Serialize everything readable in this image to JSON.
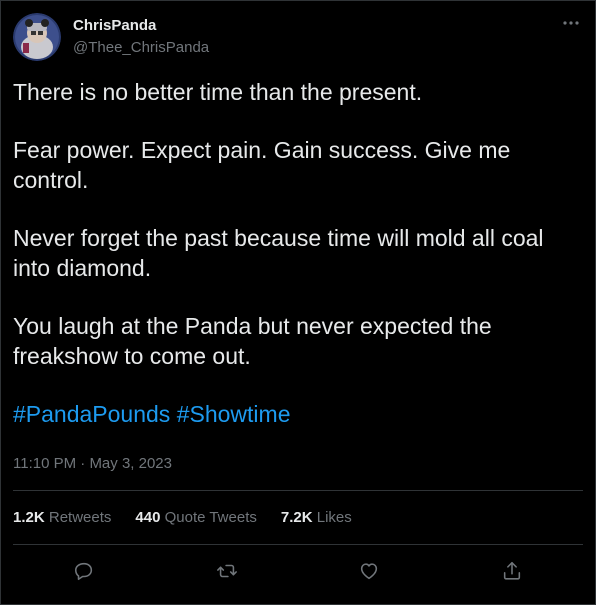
{
  "author": {
    "display_name": "ChrisPanda",
    "handle": "@Thee_ChrisPanda"
  },
  "tweet": {
    "paragraphs": [
      "There is no better time than the present.",
      "Fear power. Expect pain. Gain success. Give me\ncontrol.",
      "Never forget the past because time will mold all coal\ninto diamond.",
      "You laugh at the Panda but never expected the\nfreakshow to come out."
    ],
    "hashtags": [
      "#PandaPounds",
      "#Showtime"
    ],
    "time": "11:10 PM",
    "separator": " · ",
    "date": "May 3, 2023"
  },
  "stats": {
    "retweets": {
      "count": "1.2K",
      "label": "Retweets"
    },
    "quotes": {
      "count": "440",
      "label": "Quote Tweets"
    },
    "likes": {
      "count": "7.2K",
      "label": "Likes"
    }
  },
  "actions": [
    "reply-icon",
    "retweet-icon",
    "like-icon",
    "share-icon"
  ],
  "colors": {
    "background": "#000000",
    "text": "#e7e9ea",
    "secondary": "#71767b",
    "accent": "#1d9bf0",
    "border": "#2f3336"
  }
}
